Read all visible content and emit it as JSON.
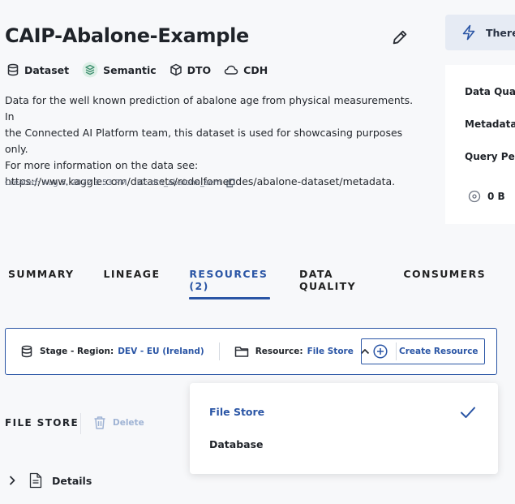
{
  "header": {
    "title": "CAIP-Abalone-Example",
    "tags": [
      {
        "icon": "database-icon",
        "label": "Dataset"
      },
      {
        "icon": "semantic-layers-icon",
        "label": "Semantic"
      },
      {
        "icon": "cube-icon",
        "label": "DTO"
      },
      {
        "icon": "cloud-icon",
        "label": "CDH"
      }
    ],
    "description_lines": [
      "Data for the well known prediction of abalone age from physical measurements. In",
      "the Connected AI Platform team, this dataset is used for showcasing purposes only.",
      "For more information on the data see:",
      "https://www.kaggle.com/datasets/rodolfomendes/abalone-dataset/metadata."
    ],
    "created": "Created: Aug 5, 2022 3:53 PM",
    "id_label": "ID: dto_abalone_sem"
  },
  "right_panel": {
    "banner_text": "There",
    "items": [
      "Data Qual",
      "Metadata",
      "Query Per"
    ],
    "size": "0 B"
  },
  "tabs": [
    {
      "label": "SUMMARY",
      "active": false
    },
    {
      "label": "LINEAGE",
      "active": false
    },
    {
      "label": "RESOURCES (2)",
      "active": true
    },
    {
      "label": "DATA QUALITY",
      "active": false
    },
    {
      "label": "CONSUMERS",
      "active": false
    }
  ],
  "filter": {
    "stage_label": "Stage - Region:",
    "stage_value": "DEV - EU (Ireland)",
    "resource_label": "Resource:",
    "resource_value": "File Store",
    "create_label": "Create Resource"
  },
  "section": {
    "title": "FILE STORE",
    "delete_label": "Delete",
    "details_label": "Details"
  },
  "dropdown": {
    "options": [
      {
        "label": "File Store",
        "selected": true
      },
      {
        "label": "Database",
        "selected": false
      }
    ]
  },
  "colors": {
    "accent": "#2a55a5",
    "background": "#f7f8fa",
    "semantic_icon": "#3f8f6f"
  }
}
